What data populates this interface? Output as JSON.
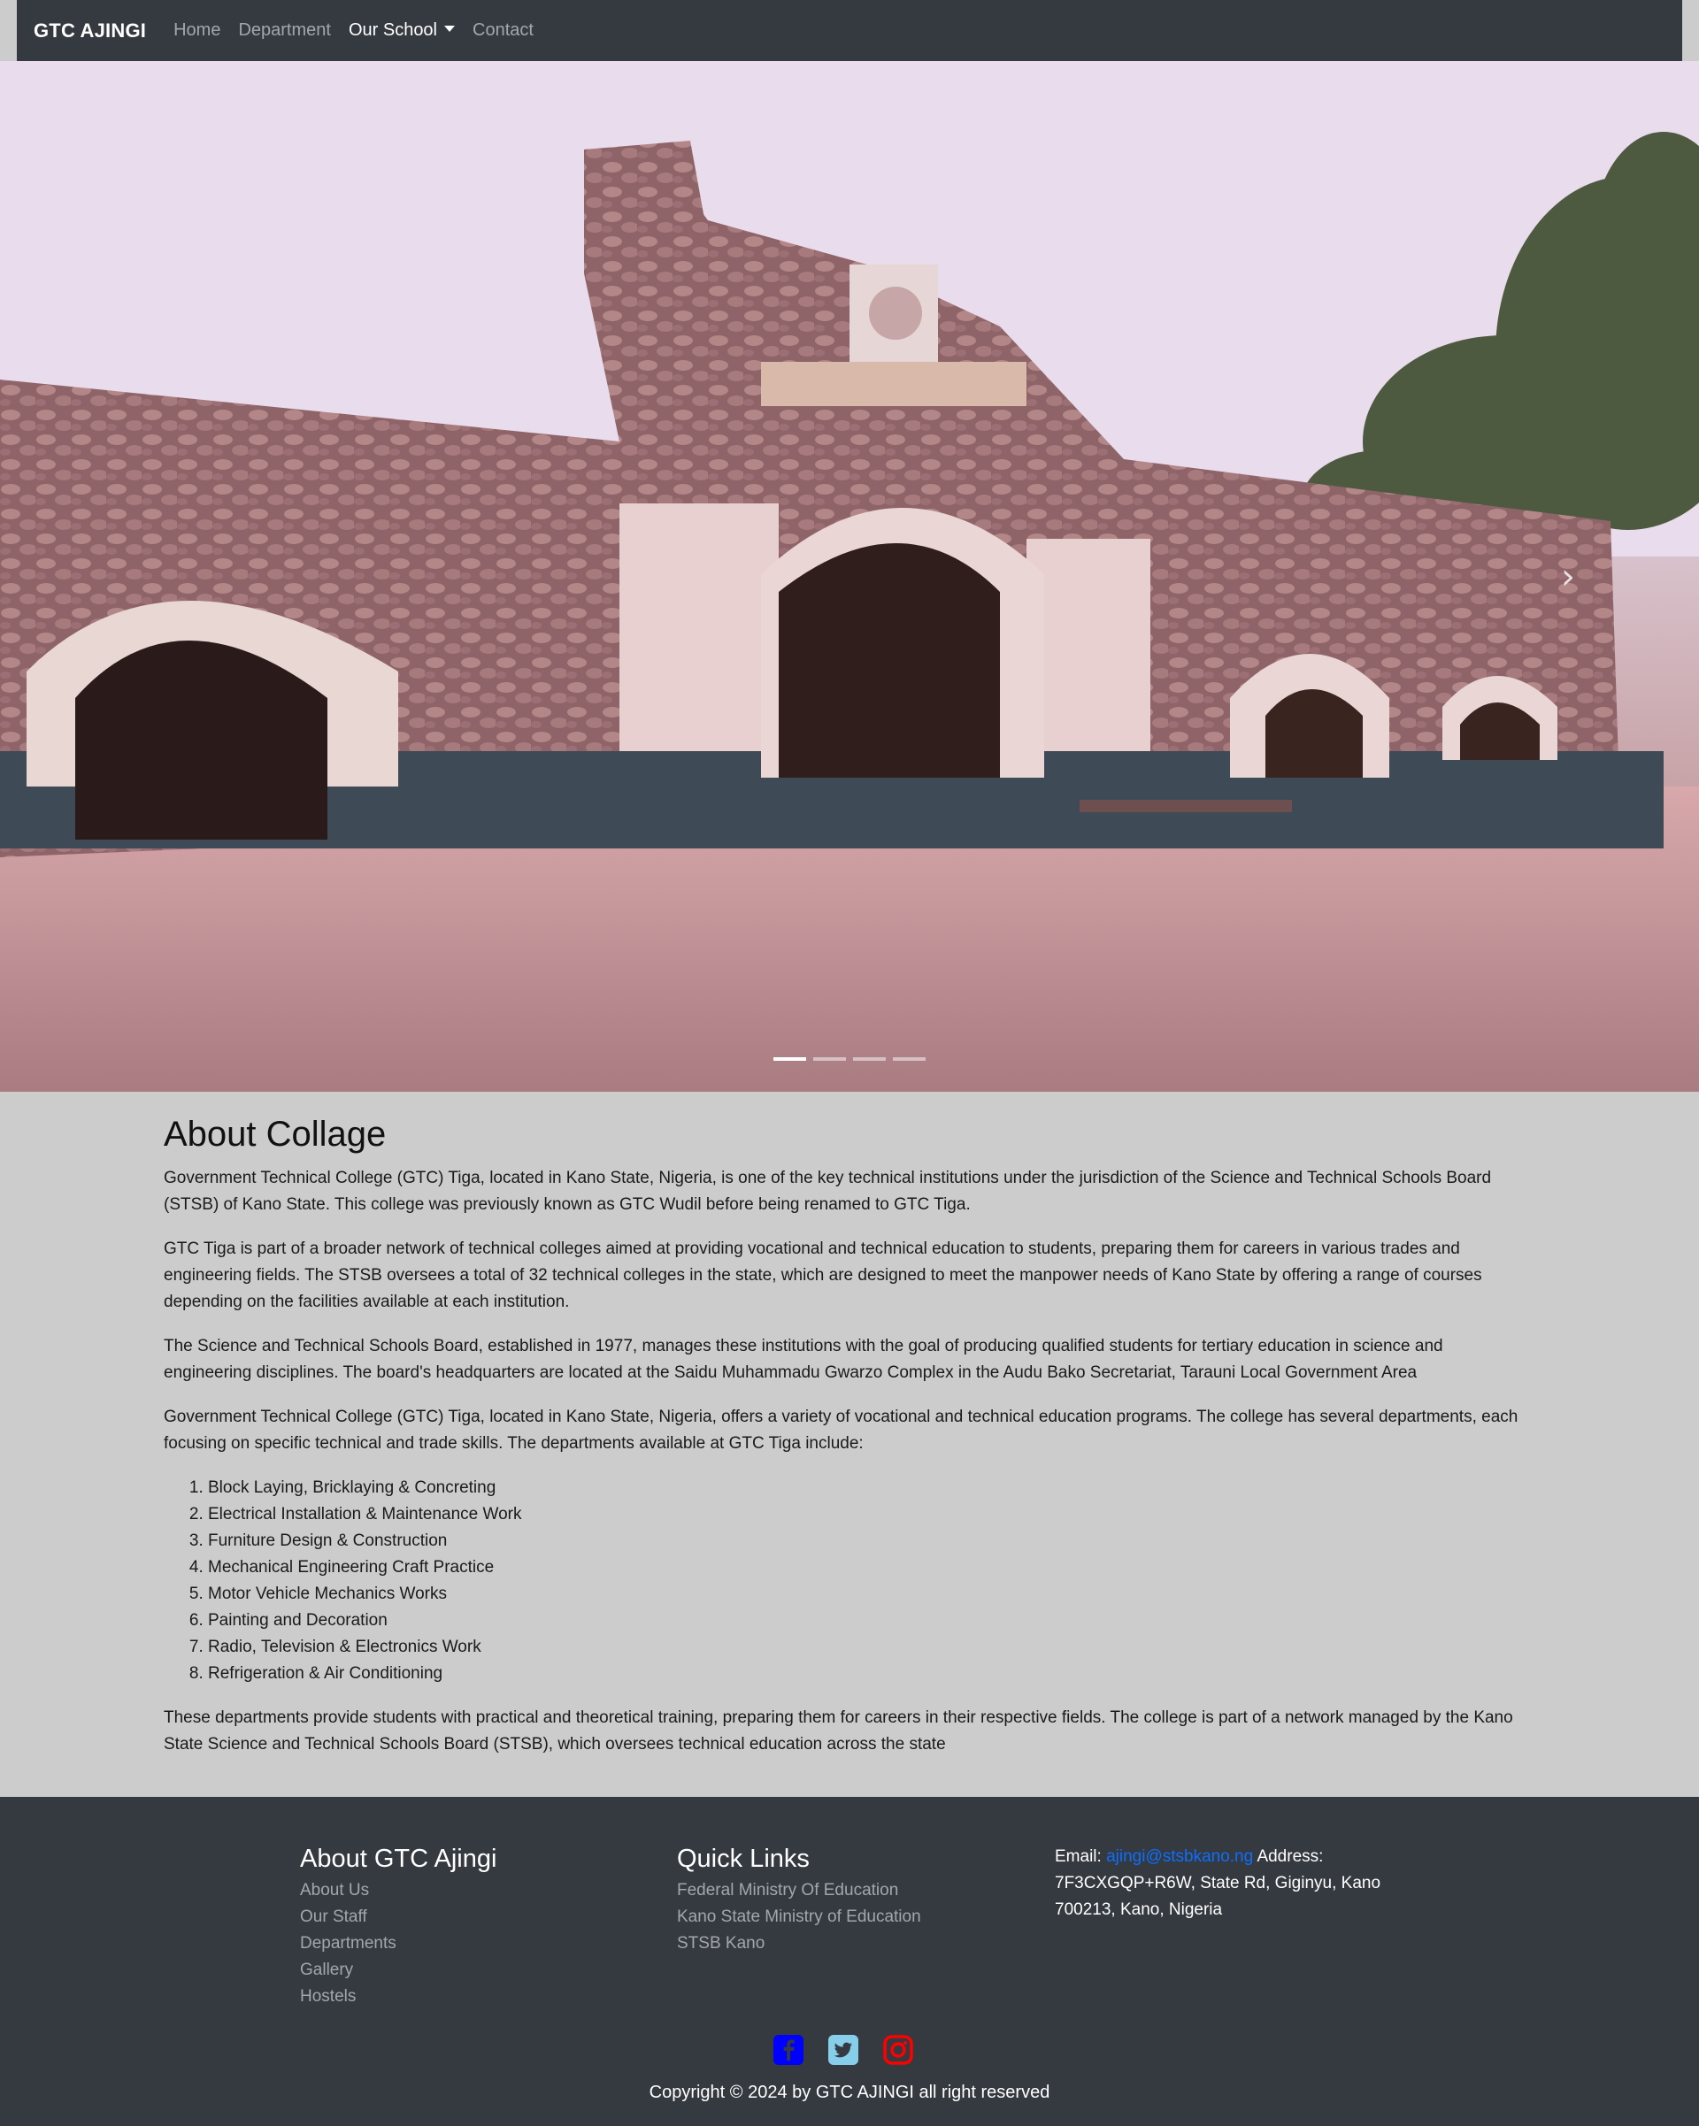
{
  "navbar": {
    "brand": "GTC AJINGI",
    "links": [
      "Home",
      "Department",
      "Our School",
      "Contact"
    ]
  },
  "hero": {
    "next_icon": "›",
    "slides": 4,
    "active_slide": 1
  },
  "about": {
    "title": "About Collage",
    "paragraphs": [
      "Government Technical College (GTC) Tiga, located in Kano State, Nigeria, is one of the key technical institutions under the jurisdiction of the Science and Technical Schools Board (STSB) of Kano State. This college was previously known as GTC Wudil before being renamed to GTC Tiga.",
      "GTC Tiga is part of a broader network of technical colleges aimed at providing vocational and technical education to students, preparing them for careers in various trades and engineering fields. The STSB oversees a total of 32 technical colleges in the state, which are designed to meet the manpower needs of Kano State by offering a range of courses depending on the facilities available at each institution.",
      "The Science and Technical Schools Board, established in 1977, manages these institutions with the goal of producing qualified students for tertiary education in science and engineering disciplines. The board's headquarters are located at the Saidu Muhammadu Gwarzo Complex in the Audu Bako Secretariat, Tarauni Local Government Area",
      "Government Technical College (GTC) Tiga, located in Kano State, Nigeria, offers a variety of vocational and technical education programs. The college has several departments, each focusing on specific technical and trade skills. The departments available at GTC Tiga include:"
    ],
    "departments": [
      "Block Laying, Bricklaying & Concreting",
      "Electrical Installation & Maintenance Work",
      "Furniture Design & Construction",
      "Mechanical Engineering Craft Practice",
      "Motor Vehicle Mechanics Works",
      "Painting and Decoration",
      "Radio, Television & Electronics Work",
      "Refrigeration & Air Conditioning"
    ],
    "closing": "These departments provide students with practical and theoretical training, preparing them for careers in their respective fields. The college is part of a network managed by the Kano State Science and Technical Schools Board (STSB), which oversees technical education across the state"
  },
  "footer": {
    "about_title": "About GTC Ajingi",
    "about_links": [
      "About Us",
      "Our Staff",
      "Departments",
      "Gallery",
      "Hostels"
    ],
    "quick_title": "Quick Links",
    "quick_links": [
      "Federal Ministry Of Education",
      "Kano State Ministry of Education",
      "STSB Kano"
    ],
    "email_label": "Email:",
    "email": "ajingi@stsbkano.ng",
    "address_label": "Address:",
    "address": "7F3CXGQP+R6W, State Rd, Giginyu, Kano 700213, Kano, Nigeria",
    "socials": [
      "facebook-icon",
      "twitter-icon",
      "instagram-icon"
    ],
    "copyright": "Copyright © 2024 by GTC AJINGI all right reserved"
  },
  "colors": {
    "navbar": "#343a40",
    "content_bg": "#cccccc",
    "link": "#0d6efd",
    "facebook": "#0000ff",
    "twitter": "#87ceeb",
    "instagram": "#ff0000"
  }
}
